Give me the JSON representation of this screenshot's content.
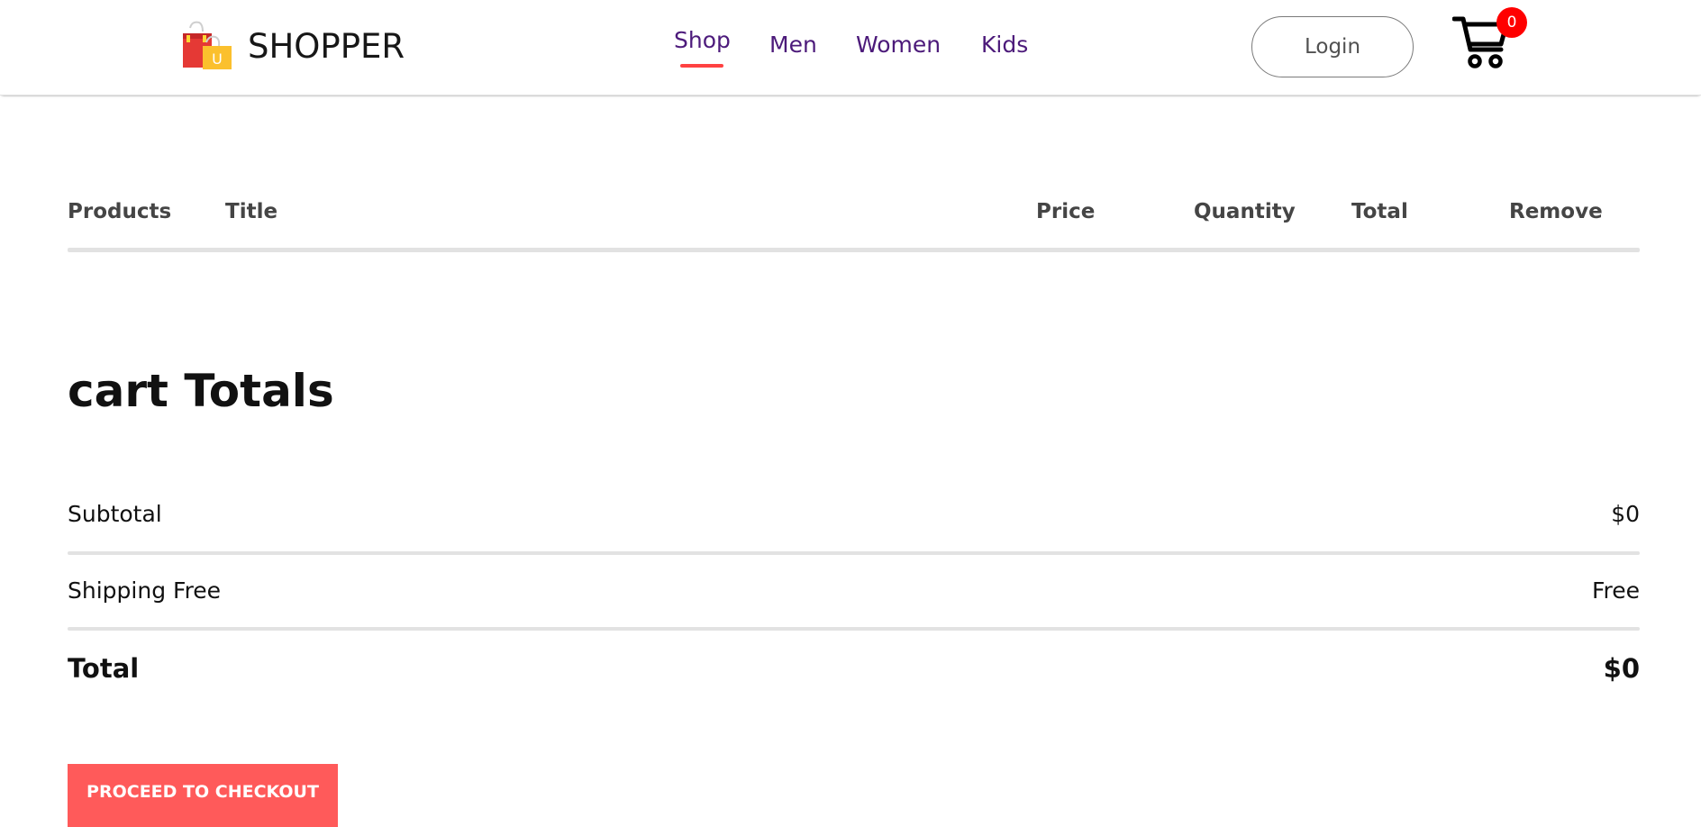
{
  "nav": {
    "brand": "SHOPPER",
    "menu": [
      {
        "label": "Shop",
        "active": true
      },
      {
        "label": "Men",
        "active": false
      },
      {
        "label": "Women",
        "active": false
      },
      {
        "label": "Kids",
        "active": false
      }
    ],
    "login_label": "Login",
    "cart_count": "0",
    "brand_icon_letter": "U",
    "accent_color": "#ff4141",
    "menu_color": "#4c1a7a"
  },
  "cart_table": {
    "headers": [
      "Products",
      "Title",
      "Price",
      "Quantity",
      "Total",
      "Remove"
    ]
  },
  "cart_totals": {
    "title": "cart Totals",
    "subtotal_label": "Subtotal",
    "subtotal_value": "$0",
    "shipping_label": "Shipping Free",
    "shipping_value": "Free",
    "total_label": "Total",
    "total_value": "$0",
    "checkout_label": "PROCEED TO CHECKOUT",
    "checkout_color": "#ff5a5a"
  }
}
